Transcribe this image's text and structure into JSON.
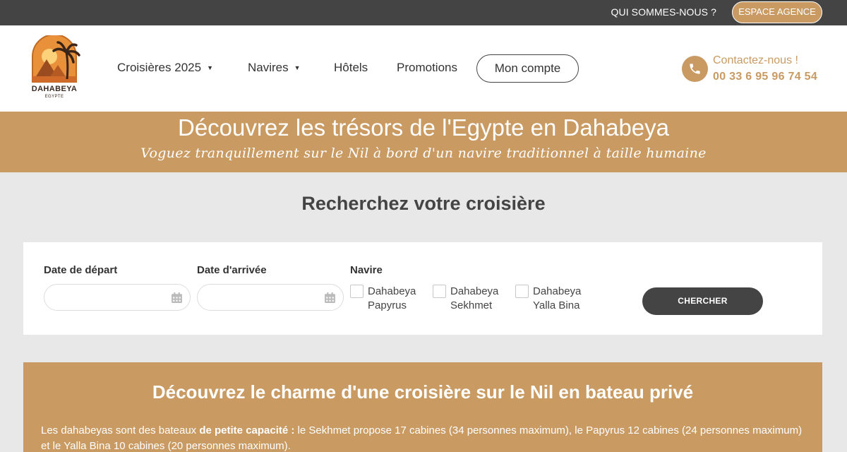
{
  "topbar": {
    "about_label": "QUI SOMMES-NOUS ?",
    "agency_label": "ESPACE AGENCE"
  },
  "logo": {
    "main": "DAHABEYA",
    "sub": "EGYPTE"
  },
  "nav": {
    "items": [
      {
        "label": "Croisières 2025",
        "has_dropdown": true
      },
      {
        "label": "Navires",
        "has_dropdown": true
      },
      {
        "label": "Hôtels",
        "has_dropdown": false
      },
      {
        "label": "Promotions",
        "has_dropdown": false
      }
    ],
    "account_label": "Mon compte",
    "dropdown_icon": "▼"
  },
  "contact": {
    "label": "Contactez-nous !",
    "number": "00 33 6 95 96 74 54",
    "icon": "phone-icon"
  },
  "hero": {
    "title": "Découvrez les trésors de l'Egypte en Dahabeya",
    "subtitle": "Voguez tranquillement sur le Nil à bord d'un navire traditionnel à taille humaine"
  },
  "search": {
    "title": "Recherchez votre croisière",
    "departure_label": "Date de départ",
    "departure_value": "",
    "arrival_label": "Date d'arrivée",
    "arrival_value": "",
    "ship_label": "Navire",
    "ships": [
      {
        "line1": "Dahabeya",
        "line2": "Papyrus",
        "checked": false
      },
      {
        "line1": "Dahabeya",
        "line2": "Sekhmet",
        "checked": false
      },
      {
        "line1": "Dahabeya",
        "line2": "Yalla Bina",
        "checked": false
      }
    ],
    "button_label": "CHERCHER"
  },
  "charm": {
    "title": "Découvrez le charme d'une croisière sur le Nil en bateau privé",
    "text_before": "Les dahabeyas sont des bateaux ",
    "text_bold": "de petite capacité :",
    "text_after": " le Sekhmet propose 17 cabines (34 personnes maximum), le Papyrus 12 cabines (24 personnes maximum) et le Yalla Bina 10 cabines (20 personnes maximum)."
  },
  "colors": {
    "accent": "#c99a62",
    "dark": "#444444",
    "background": "#e8e8e8"
  }
}
